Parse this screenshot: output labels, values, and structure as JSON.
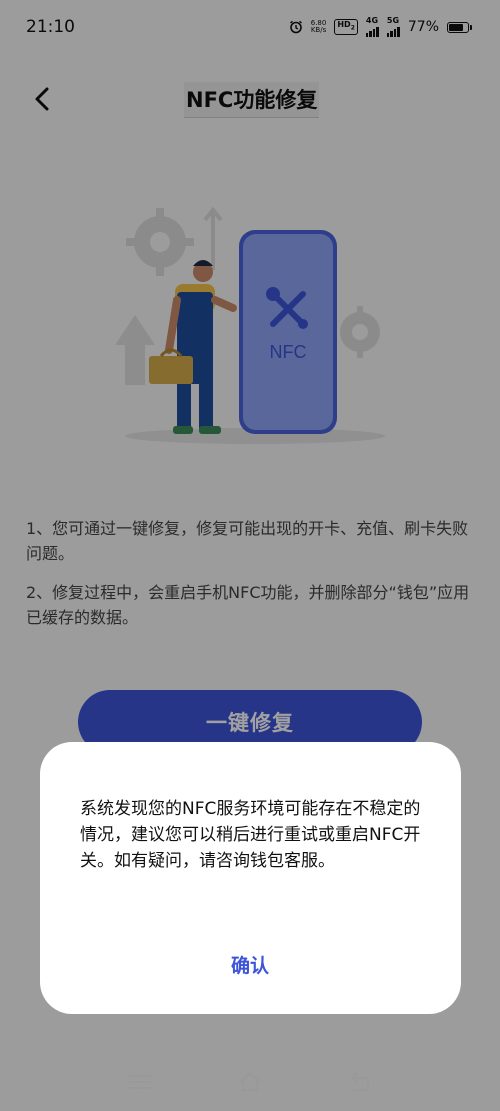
{
  "status_bar": {
    "time": "21:10",
    "net_speed_value": "6.80",
    "net_speed_unit": "KB/s",
    "hd_label": "HD",
    "hd_sub": "2",
    "sim1_label": "4G",
    "sim2_label": "5G",
    "battery_percent": "77%",
    "battery_level": 0.77
  },
  "header": {
    "title": "NFC功能修复",
    "back_icon": "chevron-left-icon"
  },
  "illustration": {
    "phone_label": "NFC",
    "tool_icon": "wrench-screwdriver-icon"
  },
  "tips": [
    "1、您可通过一键修复，修复可能出现的开卡、充值、刷卡失败问题。",
    "2、修复过程中，会重启手机NFC功能，并删除部分“钱包”应用已缓存的数据。"
  ],
  "repair_button_label": "一键修复",
  "dialog": {
    "message": "系统发现您的NFC服务环境可能存在不稳定的情况，建议您可以稍后进行重试或重启NFC开关。如有疑问，请咨询钱包客服。",
    "confirm_label": "确认"
  },
  "colors": {
    "accent": "#3d54d8",
    "overlay": "rgba(0,0,0,0.37)"
  },
  "nav_bar": {
    "icons": [
      "menu-icon",
      "home-icon",
      "back-icon"
    ]
  }
}
